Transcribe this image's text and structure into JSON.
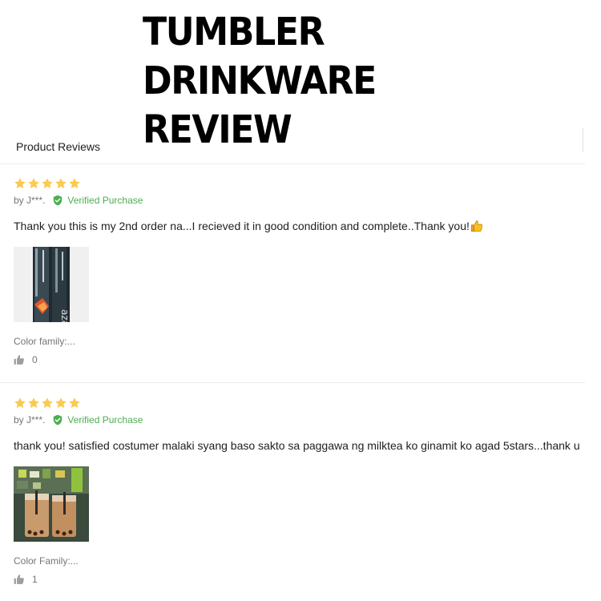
{
  "overlay_title": "TUMBLER\nDRINKWARE\nREVIEW",
  "section": {
    "label": "Product Reviews"
  },
  "colors": {
    "star": "#faca51",
    "verified": "#4caf50",
    "muted_text": "#757575",
    "divider": "#ececec"
  },
  "reviews": [
    {
      "rating": 5,
      "author": "by J***.",
      "verified_label": "Verified Purchase",
      "text": "Thank you this is my 2nd order na...I recieved it in good condition and complete..Thank you!",
      "emoji_icon": "thumbs-up-emoji",
      "photo_icon": "tumbler-photo",
      "attribute": "Color family:...",
      "likes": "0"
    },
    {
      "rating": 5,
      "author": "by J***.",
      "verified_label": "Verified Purchase",
      "text": "thank you! satisfied costumer malaki syang baso sakto sa paggawa ng milktea ko ginamit ko agad 5stars...thank u",
      "photo_icon": "milktea-photo",
      "attribute": "Color Family:...",
      "likes": "1"
    }
  ]
}
